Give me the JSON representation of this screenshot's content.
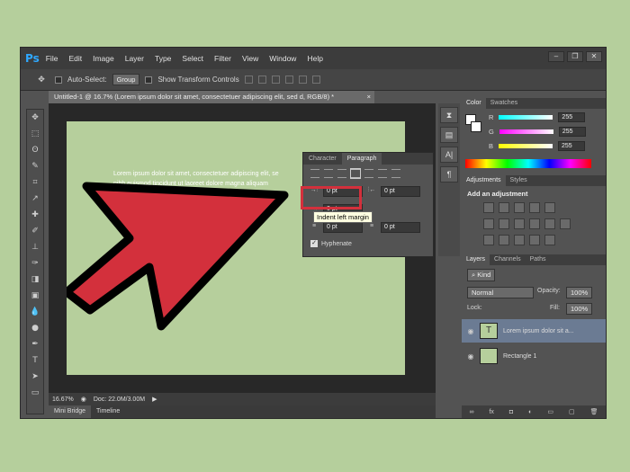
{
  "app": {
    "logo": "Ps",
    "menu": [
      "File",
      "Edit",
      "Image",
      "Layer",
      "Type",
      "Select",
      "Filter",
      "View",
      "Window",
      "Help"
    ],
    "win_buttons": [
      "–",
      "❐",
      "✕"
    ]
  },
  "options": {
    "auto_select": "Auto-Select:",
    "group": "Group",
    "transform": "Show Transform Controls"
  },
  "doc": {
    "tab": "Untitled-1 @ 16.7% (Lorem ipsum dolor sit amet, consectetuer adipiscing elit, sed d, RGB/8) *",
    "close": "×",
    "text_line1": "Lorem ipsum dolor sit amet, consectetuer adipiscing elit, se",
    "text_line2": "nibh euismod tincidunt ut laoreet dolore magna aliquam"
  },
  "status": {
    "zoom": "16.67%",
    "doc": "Doc: 22.0M/3.00M"
  },
  "bottom_tabs": [
    "Mini Bridge",
    "Timeline"
  ],
  "paragraph": {
    "tabs": [
      "Character",
      "Paragraph"
    ],
    "indent_left": "0 pt",
    "indent_right": "0 pt",
    "first_line": "0 pt",
    "space_before": "0 pt",
    "space_after": "0 pt",
    "hyphenate": "Hyphenate",
    "tooltip": "Indent left margin"
  },
  "color": {
    "tabs": [
      "Color",
      "Swatches"
    ],
    "channels": [
      {
        "label": "R",
        "value": "255"
      },
      {
        "label": "G",
        "value": "255"
      },
      {
        "label": "B",
        "value": "255"
      }
    ]
  },
  "adjustments": {
    "tabs": [
      "Adjustments",
      "Styles"
    ],
    "title": "Add an adjustment"
  },
  "layers": {
    "tabs": [
      "Layers",
      "Channels",
      "Paths"
    ],
    "kind": "⌕ Kind",
    "blend": "Normal",
    "opacity_label": "Opacity:",
    "opacity": "100%",
    "lock_label": "Lock:",
    "fill_label": "Fill:",
    "fill": "100%",
    "items": [
      {
        "name": "Lorem ipsum dolor sit a...",
        "thumb": "T"
      },
      {
        "name": "Rectangle 1",
        "thumb": ""
      }
    ]
  },
  "colors": {
    "accent_red": "#d3303c",
    "canvas": "#b6cf9c",
    "ps_blue": "#2fa8ff"
  }
}
